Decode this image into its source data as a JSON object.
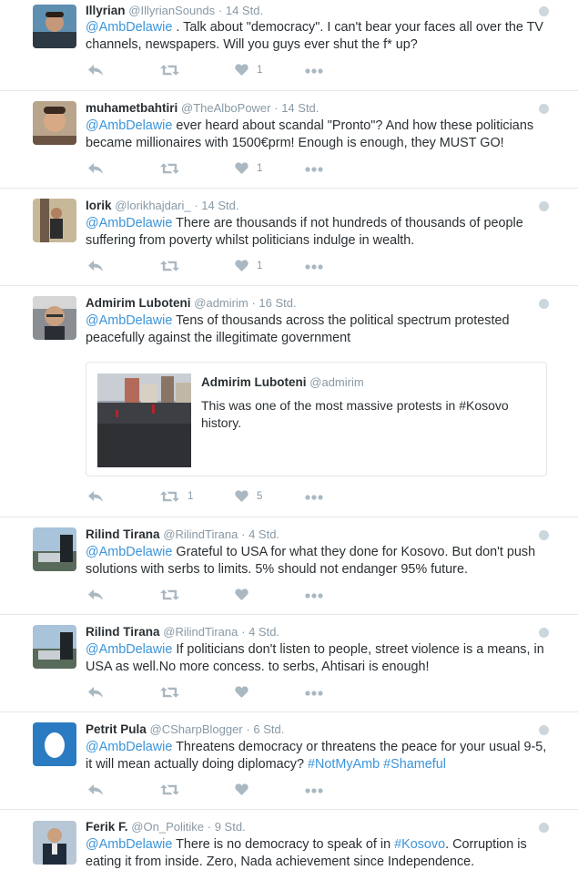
{
  "tweets": [
    {
      "name": "Illyrian",
      "handle": "@IllyrianSounds",
      "time": "· 14 Std.",
      "mention": "@AmbDelawie",
      "text": ". Talk about \"democracy\". I can't bear your faces all over the TV channels, newspapers. Will you guys ever shut the f* up?",
      "retweets": "",
      "likes": "1"
    },
    {
      "name": "muhametbahtiri",
      "handle": "@TheAlboPower",
      "time": "· 14 Std.",
      "mention": "@AmbDelawie",
      "text": "ever heard about scandal \"Pronto\"? And how these politicians became millionaires with 1500€prm! Enough is enough, they MUST GO!",
      "retweets": "",
      "likes": "1"
    },
    {
      "name": "Iorik",
      "handle": "@lorikhajdari_",
      "time": "· 14 Std.",
      "mention": "@AmbDelawie",
      "text": "There are thousands if not hundreds of thousands of people suffering from poverty whilst politicians indulge in wealth.",
      "retweets": "",
      "likes": "1"
    },
    {
      "name": "Admirim Luboteni",
      "handle": "@admirim",
      "time": "· 16 Std.",
      "mention": "@AmbDelawie",
      "text": "Tens of thousands across the political spectrum protested peacefully against the illegitimate government",
      "retweets": "1",
      "likes": "5",
      "quote": {
        "name": "Admirim Luboteni",
        "handle": "@admirim",
        "text_before": "This was one of the most massive protests in ",
        "hashtag": "#Kosovo",
        "text_after": " history."
      }
    },
    {
      "name": "Rilind Tirana",
      "handle": "@RilindTirana",
      "time": "· 4 Std.",
      "mention": "@AmbDelawie",
      "text": "Grateful to USA for what they done for Kosovo. But don't push solutions with serbs to limits. 5% should not endanger 95% future.",
      "retweets": "",
      "likes": ""
    },
    {
      "name": "Rilind Tirana",
      "handle": "@RilindTirana",
      "time": "· 4 Std.",
      "mention": "@AmbDelawie",
      "text": "If politicians don't listen to people, street violence is a means, in USA as well.No more concess. to serbs, Ahtisari is enough!",
      "retweets": "",
      "likes": ""
    },
    {
      "name": "Petrit Pula",
      "handle": "@CSharpBlogger",
      "time": "· 6 Std.",
      "mention": "@AmbDelawie",
      "text": "Threatens democracy or threatens the peace for your usual 9-5, it will mean actually doing diplomacy?",
      "hashtag1": "#NotMyAmb",
      "hashtag2": "#Shameful",
      "retweets": "",
      "likes": ""
    },
    {
      "name": "Ferik F.",
      "handle": "@On_Politike",
      "time": "· 9 Std.",
      "mention": "@AmbDelawie",
      "text_before": "There is no democracy to speak of in ",
      "hashtag1": "#Kosovo",
      "text_after": ". Corruption is eating it from inside. Zero, Nada achievement since Independence."
    }
  ],
  "icons": {
    "reply": "reply-icon",
    "retweet": "retweet-icon",
    "like": "heart-icon",
    "more": "more-icon",
    "globe": "globe-icon"
  },
  "colors": {
    "link": "#3b94d9",
    "icon": "#aab8c2",
    "muted": "#8899a6",
    "text": "#292f33"
  }
}
